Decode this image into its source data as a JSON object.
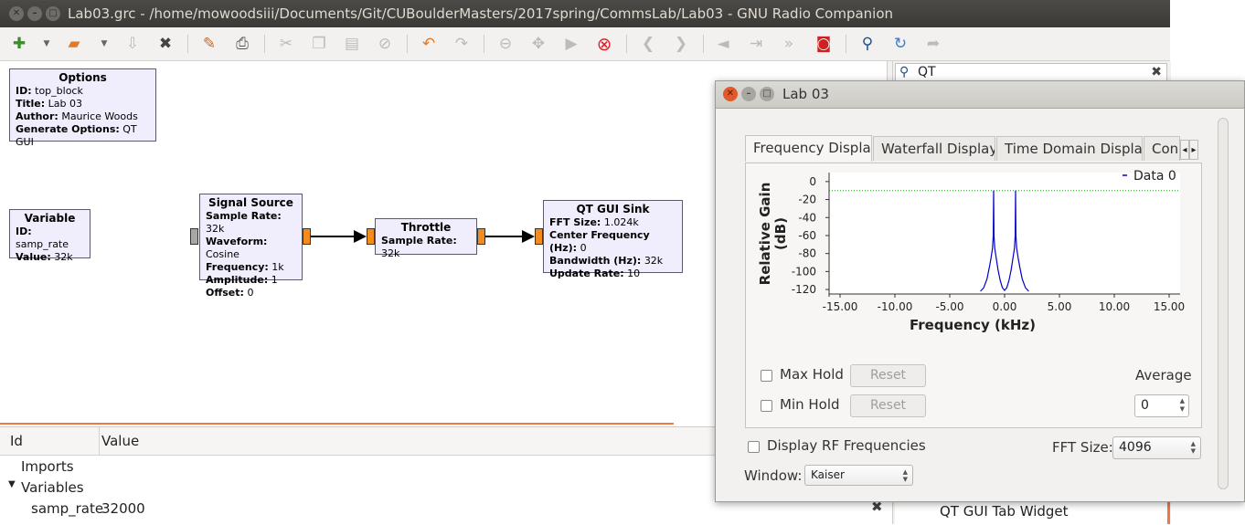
{
  "window": {
    "title": "Lab03.grc - /home/mowoodsiii/Documents/Git/CUBoulderMasters/2017spring/CommsLab/Lab03 - GNU Radio Companion"
  },
  "toolbar": {
    "icons": [
      "new-icon",
      "new-dropdown-icon",
      "open-icon",
      "open-dropdown-icon",
      "save-icon",
      "close-icon",
      "properties-icon",
      "print-icon",
      "cut-icon",
      "copy-icon",
      "paste-icon",
      "delete-icon",
      "undo-icon",
      "redo-icon",
      "disable-icon",
      "bypass-icon",
      "execute-icon",
      "kill-icon",
      "rotate-left-icon",
      "rotate-right-icon",
      "create-hier-icon",
      "open-hier-icon",
      "forward-icon",
      "screenshot-icon",
      "find-icon",
      "reload-icon",
      "rerouted-icon"
    ]
  },
  "blocks": {
    "options": {
      "title": "Options",
      "rows": [
        {
          "k": "ID:",
          "v": "top_block"
        },
        {
          "k": "Title:",
          "v": "Lab 03"
        },
        {
          "k": "Author:",
          "v": "Maurice Woods"
        },
        {
          "k": "Generate Options:",
          "v": "QT GUI"
        }
      ]
    },
    "variable": {
      "title": "Variable",
      "rows": [
        {
          "k": "ID:",
          "v": "samp_rate"
        },
        {
          "k": "Value:",
          "v": "32k"
        }
      ]
    },
    "signal_source": {
      "title": "Signal Source",
      "rows": [
        {
          "k": "Sample Rate:",
          "v": "32k"
        },
        {
          "k": "Waveform:",
          "v": "Cosine"
        },
        {
          "k": "Frequency:",
          "v": "1k"
        },
        {
          "k": "Amplitude:",
          "v": "1"
        },
        {
          "k": "Offset:",
          "v": "0"
        }
      ]
    },
    "throttle": {
      "title": "Throttle",
      "rows": [
        {
          "k": "Sample Rate:",
          "v": "32k"
        }
      ]
    },
    "qt_gui_sink": {
      "title": "QT GUI Sink",
      "rows": [
        {
          "k": "FFT Size:",
          "v": "1.024k"
        },
        {
          "k": "Center Frequency (Hz):",
          "v": "0"
        },
        {
          "k": "Bandwidth (Hz):",
          "v": "32k"
        },
        {
          "k": "Update Rate:",
          "v": "10"
        }
      ]
    }
  },
  "variables_panel": {
    "col_id": "Id",
    "col_value": "Value",
    "imports": "Imports",
    "variables": "Variables",
    "var_id": "samp_rate",
    "var_value": "32000"
  },
  "block_tree": {
    "search_value": "QT",
    "bottom_item": "QT GUI Tab Widget"
  },
  "dialog": {
    "title": "Lab 03",
    "tabs": [
      "Frequency Display",
      "Waterfall Display",
      "Time Domain Display",
      "Con"
    ],
    "active_tab": 0,
    "max_hold": "Max Hold",
    "min_hold": "Min Hold",
    "reset": "Reset",
    "average_label": "Average",
    "average_value": "0",
    "display_rf": "Display RF Frequencies",
    "fft_size_label": "FFT Size:",
    "fft_size_value": "4096",
    "window_label": "Window:",
    "window_value": "Kaiser"
  },
  "chart_data": {
    "type": "line",
    "xlabel": "Frequency (kHz)",
    "ylabel": "Relative Gain (dB)",
    "xlim": [
      -16,
      16
    ],
    "ylim": [
      -125,
      10
    ],
    "xticks": [
      "-15.00",
      "-10.00",
      "-5.00",
      "0.00",
      "5.00",
      "10.00",
      "15.00"
    ],
    "yticks": [
      "0",
      "-20",
      "-40",
      "-60",
      "-80",
      "-100",
      "-120"
    ],
    "legend": "top-right",
    "series": [
      {
        "name": "Data 0",
        "color": "#0000cc",
        "x": [
          -2.2,
          -1.9,
          -1.6,
          -1.4,
          -1.25,
          -1.1,
          -1.03,
          -1.0,
          -0.97,
          -0.9,
          -0.75,
          -0.6,
          -0.4,
          -0.2,
          0,
          0.2,
          0.4,
          0.6,
          0.75,
          0.9,
          0.97,
          1.0,
          1.03,
          1.1,
          1.25,
          1.4,
          1.6,
          1.9,
          2.2
        ],
        "y": [
          -122,
          -118,
          -108,
          -96,
          -86,
          -74,
          -60,
          -10,
          -60,
          -74,
          -86,
          -98,
          -110,
          -118,
          -121,
          -118,
          -110,
          -98,
          -86,
          -74,
          -60,
          -10,
          -60,
          -74,
          -86,
          -96,
          -108,
          -118,
          -122
        ]
      }
    ],
    "reference": {
      "y": -10,
      "color": "#00b000",
      "style": "dotted"
    }
  }
}
